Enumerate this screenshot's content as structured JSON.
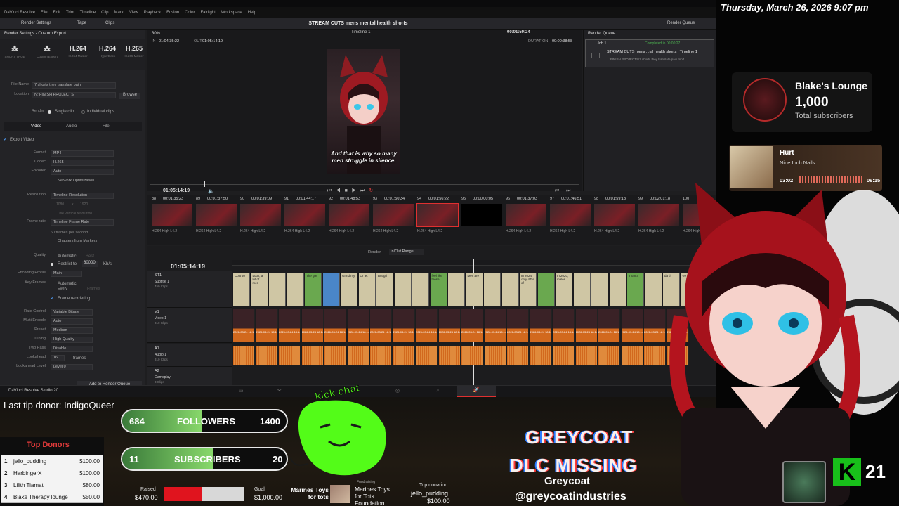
{
  "datetime": "Thursday, March 26, 2026 9:07 pm",
  "resolve": {
    "menu": [
      "DaVinci Resolve",
      "File",
      "Edit",
      "Trim",
      "Timeline",
      "Clip",
      "Mark",
      "View",
      "Playback",
      "Fusion",
      "Color",
      "Fairlight",
      "Workspace",
      "Help"
    ],
    "tabs": {
      "render_settings": "Render Settings",
      "tape": "Tape",
      "clips": "Clips",
      "render_queue": "Render Queue"
    },
    "project_title": "STREAM CUTS mens mental health shorts",
    "left": {
      "header": "Render Settings - Custom Export",
      "presets": [
        {
          "name": "H.264",
          "sub": "Custom Export"
        },
        {
          "name": "H.264",
          "sub": "H.264 Master"
        },
        {
          "name": "H.264",
          "sub": "HyperDeck"
        },
        {
          "name": "H.265",
          "sub": "H.265 Master"
        }
      ],
      "preset_first": "SHORT TRUE",
      "filename_label": "File Name",
      "filename": "7 shorts they translate pain",
      "location_label": "Location",
      "location": "N:\\FINISH PROJECTS",
      "browse": "Browse",
      "render_label": "Render",
      "single_clip": "Single clip",
      "individual_clips": "Individual clips",
      "subtabs": [
        "Video",
        "Audio",
        "File"
      ],
      "export_video": "Export Video",
      "fields": [
        {
          "label": "Format",
          "value": "MP4"
        },
        {
          "label": "Codec",
          "value": "H.265"
        },
        {
          "label": "Encoder",
          "value": "Auto"
        }
      ],
      "network_opt": "Network Optimization",
      "resolution_label": "Resolution",
      "resolution": "Timeline Resolution",
      "res_w": "1080",
      "res_x": "x",
      "res_h": "1920",
      "use_vertical": "Use vertical resolution",
      "framerate_label": "Frame rate",
      "framerate": "Timeline Frame Rate",
      "fps_note": "60 frames per second",
      "chapters": "Chapters from Markers",
      "quality_label": "Quality",
      "quality_auto": "Automatic",
      "quality_best": "Best",
      "restrict": "Restrict to",
      "bitrate": "80000",
      "kbs": "Kb/s",
      "enc_profile_label": "Encoding Profile",
      "enc_profile": "Main",
      "keyframes_label": "Key Frames",
      "kf_auto": "Automatic",
      "kf_every": "Every",
      "kf_frames": "Frames",
      "frame_reorder": "Frame reordering",
      "rate_control_label": "Rate Control",
      "rate_control": "Variable Bitrate",
      "multi_encode_label": "Multi Encode",
      "multi_encode": "Auto",
      "preset_label": "Preset",
      "preset": "Medium",
      "tuning_label": "Tuning",
      "tuning": "High Quality",
      "two_pass_label": "Two Pass",
      "two_pass": "Disable",
      "lookahead_label": "Lookahead",
      "lookahead": "16",
      "lookahead_unit": "frames",
      "lookahead_level_label": "Lookahead Level",
      "lookahead_level": "Level 0",
      "add_queue": "Add to Render Queue"
    },
    "viewer": {
      "zoom": "30%",
      "timeline_name": "Timeline 1",
      "tc_top": "00:01:59:24",
      "in_label": "IN",
      "in_tc": "01:04:35:22",
      "out_label": "OUT",
      "out_tc": "01:05:14:19",
      "duration_label": "DURATION",
      "duration": "00:00:38:58",
      "subtitle": "And that is why so many men struggle in silence.",
      "playhead_tc": "01:05:14:19"
    },
    "queue": {
      "header": "Render Queue",
      "job": "Job 1",
      "status": "Completed in 00:00:27",
      "title": "STREAM CUTS mens ...tal health shorts | Timeline 1",
      "path": "...\\FINISH PROJECTS\\7 shorts they translate pain.mp4"
    },
    "thumbs": [
      {
        "num": "88",
        "tc": "00:01:35:23",
        "lbl": "H.264 High L4.2"
      },
      {
        "num": "89",
        "tc": "00:01:37:50",
        "lbl": "H.264 High L4.2"
      },
      {
        "num": "90",
        "tc": "00:01:39:09",
        "lbl": "H.264 High L4.2"
      },
      {
        "num": "91",
        "tc": "00:01:44:17",
        "lbl": "H.264 High L4.2"
      },
      {
        "num": "92",
        "tc": "00:01:48:53",
        "lbl": "H.264 High L4.2"
      },
      {
        "num": "93",
        "tc": "00:01:50:34",
        "lbl": "H.264 High L4.2"
      },
      {
        "num": "94",
        "tc": "00:01:56:22",
        "lbl": "H.264 High L4.2"
      },
      {
        "num": "95",
        "tc": "00:00:00:05",
        "lbl": ""
      },
      {
        "num": "96",
        "tc": "00:01:37:03",
        "lbl": "H.264 High L4.2"
      },
      {
        "num": "97",
        "tc": "00:01:46:51",
        "lbl": "H.264 High L4.2"
      },
      {
        "num": "98",
        "tc": "00:01:59:13",
        "lbl": "H.264 High L4.2"
      },
      {
        "num": "99",
        "tc": "00:02:01:18",
        "lbl": "H.264 High L4.2"
      },
      {
        "num": "100",
        "tc": "",
        "lbl": "H.264 High L4.2"
      }
    ],
    "timeline": {
      "render_label": "Render",
      "render_range": "In/Out Range",
      "tc": "01:05:14:19",
      "tracks": [
        {
          "id": "ST1",
          "name": "Subtitle 1",
          "count": "450 Clips"
        },
        {
          "id": "V1",
          "name": "Video 1",
          "count": "310 Clips"
        },
        {
          "id": "A1",
          "name": "Audio 1",
          "count": "310 Clips"
        },
        {
          "id": "A2",
          "name": "Gameplay",
          "count": "3 Clips"
        }
      ],
      "sub_words": [
        "Co troo",
        "Look, a lot of men",
        "",
        "",
        "The gre",
        "",
        "Grind my",
        "Or let",
        "But gri",
        "",
        "",
        "feel like these",
        "",
        "Men are",
        "",
        "",
        "In 2024, only 47% of",
        "",
        "In 2020, males",
        "",
        "",
        "",
        "Than a",
        "",
        "da th",
        "we"
      ],
      "clip_label": "2026-03-24 18:14..."
    },
    "brand": "DaVinci Resolve Studio 20"
  },
  "overlay": {
    "last_tip": "Last tip donor: IndigoQueer",
    "top_donors_title": "Top Donors",
    "donors": [
      {
        "rank": "1",
        "name": "jello_pudding",
        "amount": "$100.00"
      },
      {
        "rank": "2",
        "name": "HarbingerX",
        "amount": "$100.00"
      },
      {
        "rank": "3",
        "name": "Lilith Tiamat",
        "amount": "$80.00"
      },
      {
        "rank": "4",
        "name": "Blake Therapy lounge",
        "amount": "$50.00"
      }
    ],
    "followers": {
      "current": "684",
      "label": "FOLLOWERS",
      "goal": "1400",
      "progress": 0.489
    },
    "subscribers": {
      "current": "11",
      "label": "SUBSCRIBERS",
      "goal": "20",
      "progress": 0.55
    },
    "kick_chat": "kick chat",
    "raised_label": "Raised",
    "raised": "$470.00",
    "goal_label": "Goal",
    "goal": "$1,000.00",
    "goal_progress": 0.47,
    "charity_name": "Marines Toys for tots",
    "charity_label": "Fundraising",
    "charity_full": "Marines Toys for Tots Foundation",
    "top_donation_label": "Top donation",
    "top_donation_name": "jello_pudding",
    "top_donation_amount": "$100.00",
    "game_title_1": "GREYCOAT",
    "game_title_2": "DLC MISSING",
    "sponsor_name": "Greycoat",
    "sponsor_handle": "@greycoatindustries",
    "channel": {
      "name": "Blake's Lounge",
      "count": "1,000",
      "label": "Total subscribers"
    },
    "music": {
      "title": "Hurt",
      "artist": "Nine Inch Nails",
      "elapsed": "03:02",
      "total": "06:15",
      "progress": 0.485
    },
    "k_count": "21"
  },
  "colors": {
    "kick_green": "#53fc18",
    "resolve_bg": "#1e1e20",
    "video_clip": "#d2691e",
    "subtitle_clip": "#cfc6a4",
    "accent_red": "#e03030"
  }
}
